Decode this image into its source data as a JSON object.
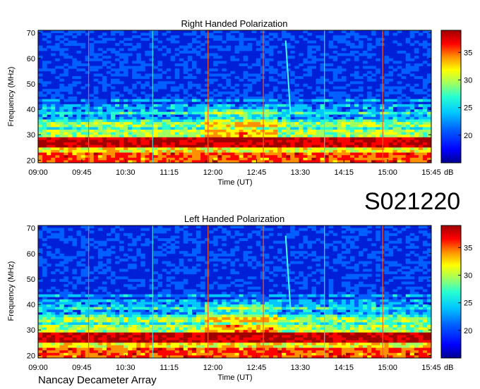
{
  "observation_id": "S021220",
  "footer": "Nancay Decameter Array",
  "colors": {
    "spectrum": [
      "#000090",
      "#0000ff",
      "#0060ff",
      "#00c8ff",
      "#28ffd0",
      "#a0ff60",
      "#ffff00",
      "#ff9000",
      "#ff0000",
      "#a00000"
    ],
    "marker_orange": "#ff5a1e",
    "marker_cyan": "#40e0e0"
  },
  "chart_data": [
    {
      "type": "heatmap",
      "title": "Right Handed Polarization",
      "xlabel": "Time (UT)",
      "ylabel": "Frequency (MHz)",
      "x_ticks": [
        "09:00",
        "09:45",
        "10:30",
        "11:15",
        "12:00",
        "12:45",
        "13:30",
        "14:15",
        "15:00",
        "15:45"
      ],
      "y_ticks": [
        20,
        30,
        40,
        50,
        60,
        70
      ],
      "ylim": [
        19,
        71
      ],
      "colorbar": {
        "label": "dB",
        "ticks": [
          20,
          25,
          30,
          35
        ],
        "range": [
          15,
          39
        ]
      },
      "markers": [
        {
          "time": "09:00",
          "color": "orange"
        },
        {
          "time": "09:52",
          "color": "orange"
        },
        {
          "time": "10:58",
          "color": "cyan"
        },
        {
          "time": "11:55",
          "color": "orange"
        },
        {
          "time": "12:52",
          "color": "orange"
        },
        {
          "time": "13:55",
          "color": "cyan"
        },
        {
          "time": "14:55",
          "color": "orange"
        }
      ],
      "burst": {
        "start_time": "13:15",
        "end_time": "13:20",
        "freq_start": 67,
        "freq_end": 38
      }
    },
    {
      "type": "heatmap",
      "title": "Left Handed Polarization",
      "xlabel": "Time (UT)",
      "ylabel": "Frequency (MHz)",
      "x_ticks": [
        "09:00",
        "09:45",
        "10:30",
        "11:15",
        "12:00",
        "12:45",
        "13:30",
        "14:15",
        "15:00",
        "15:45"
      ],
      "y_ticks": [
        20,
        30,
        40,
        50,
        60,
        70
      ],
      "ylim": [
        19,
        71
      ],
      "colorbar": {
        "label": "dB",
        "ticks": [
          20,
          25,
          30,
          35
        ],
        "range": [
          15,
          39
        ]
      },
      "markers": [
        {
          "time": "09:00",
          "color": "orange"
        },
        {
          "time": "09:52",
          "color": "orange"
        },
        {
          "time": "10:58",
          "color": "cyan"
        },
        {
          "time": "11:55",
          "color": "orange"
        },
        {
          "time": "12:52",
          "color": "orange"
        },
        {
          "time": "13:55",
          "color": "cyan"
        },
        {
          "time": "14:55",
          "color": "orange"
        }
      ],
      "burst": {
        "start_time": "13:15",
        "end_time": "13:20",
        "freq_start": 67,
        "freq_end": 38
      }
    }
  ]
}
